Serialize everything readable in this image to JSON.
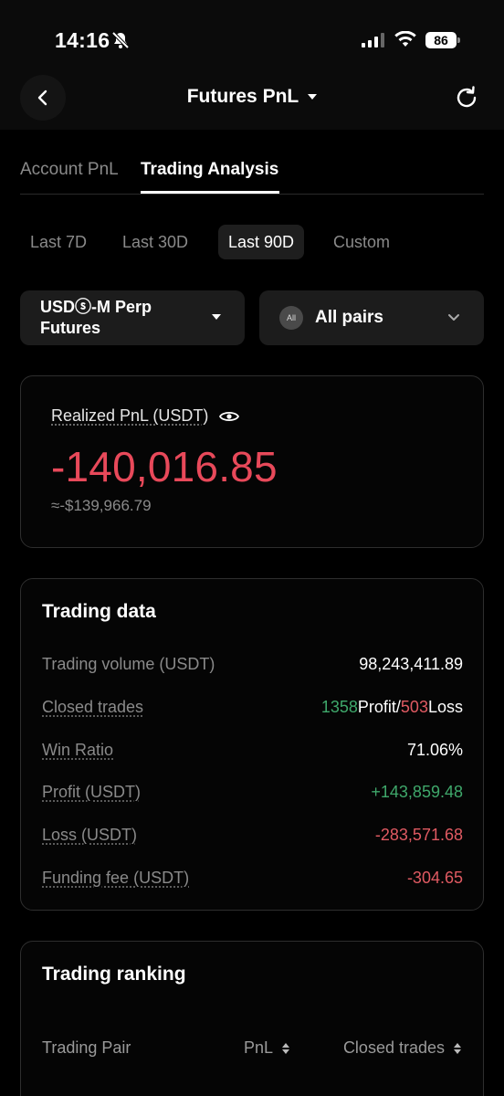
{
  "status": {
    "time": "14:16",
    "battery": "86"
  },
  "header": {
    "title": "Futures PnL"
  },
  "tabs": [
    {
      "label": "Account PnL",
      "active": false
    },
    {
      "label": "Trading Analysis",
      "active": true
    }
  ],
  "periods": [
    {
      "label": "Last 7D",
      "active": false
    },
    {
      "label": "Last 30D",
      "active": false
    },
    {
      "label": "Last 90D",
      "active": true
    },
    {
      "label": "Custom",
      "active": false
    }
  ],
  "selectors": {
    "product": "USDⓢ-M Perp Futures",
    "pairs_badge": "All",
    "pairs": "All pairs"
  },
  "pnl": {
    "label": "Realized PnL (USDT)",
    "value": "-140,016.85",
    "approx": "≈-$139,966.79"
  },
  "trading_data": {
    "title": "Trading data",
    "rows": [
      {
        "label": "Trading volume (USDT)",
        "value": "98,243,411.89"
      },
      {
        "label": "Closed trades",
        "profit_count": "1358",
        "profit_word": "Profit",
        "sep": "/",
        "loss_count": "503",
        "loss_word": "Loss"
      },
      {
        "label": "Win Ratio",
        "value": "71.06%"
      },
      {
        "label": "Profit (USDT)",
        "value": "+143,859.48"
      },
      {
        "label": "Loss (USDT)",
        "value": "-283,571.68"
      },
      {
        "label": "Funding fee (USDT)",
        "value": "-304.65"
      }
    ]
  },
  "ranking": {
    "title": "Trading ranking",
    "columns": [
      "Trading Pair",
      "PnL",
      "Closed trades"
    ]
  },
  "colors": {
    "loss": "#e8495a",
    "profit": "#3fa86b",
    "background": "#000000"
  }
}
